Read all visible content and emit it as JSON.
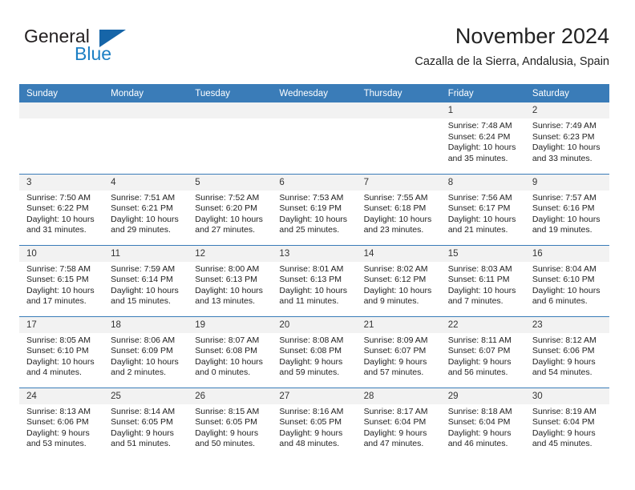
{
  "brand": {
    "name_part1": "General",
    "name_part2": "Blue"
  },
  "header": {
    "title": "November 2024",
    "subtitle": "Cazalla de la Sierra, Andalusia, Spain"
  },
  "colors": {
    "header_blue": "#3a7cb8",
    "brand_blue": "#1c7fc4",
    "daynum_band": "#f2f2f2"
  },
  "weekdays": [
    "Sunday",
    "Monday",
    "Tuesday",
    "Wednesday",
    "Thursday",
    "Friday",
    "Saturday"
  ],
  "weeks": [
    [
      {
        "day": "",
        "lines": []
      },
      {
        "day": "",
        "lines": []
      },
      {
        "day": "",
        "lines": []
      },
      {
        "day": "",
        "lines": []
      },
      {
        "day": "",
        "lines": []
      },
      {
        "day": "1",
        "lines": [
          "Sunrise: 7:48 AM",
          "Sunset: 6:24 PM",
          "Daylight: 10 hours",
          "and 35 minutes."
        ]
      },
      {
        "day": "2",
        "lines": [
          "Sunrise: 7:49 AM",
          "Sunset: 6:23 PM",
          "Daylight: 10 hours",
          "and 33 minutes."
        ]
      }
    ],
    [
      {
        "day": "3",
        "lines": [
          "Sunrise: 7:50 AM",
          "Sunset: 6:22 PM",
          "Daylight: 10 hours",
          "and 31 minutes."
        ]
      },
      {
        "day": "4",
        "lines": [
          "Sunrise: 7:51 AM",
          "Sunset: 6:21 PM",
          "Daylight: 10 hours",
          "and 29 minutes."
        ]
      },
      {
        "day": "5",
        "lines": [
          "Sunrise: 7:52 AM",
          "Sunset: 6:20 PM",
          "Daylight: 10 hours",
          "and 27 minutes."
        ]
      },
      {
        "day": "6",
        "lines": [
          "Sunrise: 7:53 AM",
          "Sunset: 6:19 PM",
          "Daylight: 10 hours",
          "and 25 minutes."
        ]
      },
      {
        "day": "7",
        "lines": [
          "Sunrise: 7:55 AM",
          "Sunset: 6:18 PM",
          "Daylight: 10 hours",
          "and 23 minutes."
        ]
      },
      {
        "day": "8",
        "lines": [
          "Sunrise: 7:56 AM",
          "Sunset: 6:17 PM",
          "Daylight: 10 hours",
          "and 21 minutes."
        ]
      },
      {
        "day": "9",
        "lines": [
          "Sunrise: 7:57 AM",
          "Sunset: 6:16 PM",
          "Daylight: 10 hours",
          "and 19 minutes."
        ]
      }
    ],
    [
      {
        "day": "10",
        "lines": [
          "Sunrise: 7:58 AM",
          "Sunset: 6:15 PM",
          "Daylight: 10 hours",
          "and 17 minutes."
        ]
      },
      {
        "day": "11",
        "lines": [
          "Sunrise: 7:59 AM",
          "Sunset: 6:14 PM",
          "Daylight: 10 hours",
          "and 15 minutes."
        ]
      },
      {
        "day": "12",
        "lines": [
          "Sunrise: 8:00 AM",
          "Sunset: 6:13 PM",
          "Daylight: 10 hours",
          "and 13 minutes."
        ]
      },
      {
        "day": "13",
        "lines": [
          "Sunrise: 8:01 AM",
          "Sunset: 6:13 PM",
          "Daylight: 10 hours",
          "and 11 minutes."
        ]
      },
      {
        "day": "14",
        "lines": [
          "Sunrise: 8:02 AM",
          "Sunset: 6:12 PM",
          "Daylight: 10 hours",
          "and 9 minutes."
        ]
      },
      {
        "day": "15",
        "lines": [
          "Sunrise: 8:03 AM",
          "Sunset: 6:11 PM",
          "Daylight: 10 hours",
          "and 7 minutes."
        ]
      },
      {
        "day": "16",
        "lines": [
          "Sunrise: 8:04 AM",
          "Sunset: 6:10 PM",
          "Daylight: 10 hours",
          "and 6 minutes."
        ]
      }
    ],
    [
      {
        "day": "17",
        "lines": [
          "Sunrise: 8:05 AM",
          "Sunset: 6:10 PM",
          "Daylight: 10 hours",
          "and 4 minutes."
        ]
      },
      {
        "day": "18",
        "lines": [
          "Sunrise: 8:06 AM",
          "Sunset: 6:09 PM",
          "Daylight: 10 hours",
          "and 2 minutes."
        ]
      },
      {
        "day": "19",
        "lines": [
          "Sunrise: 8:07 AM",
          "Sunset: 6:08 PM",
          "Daylight: 10 hours",
          "and 0 minutes."
        ]
      },
      {
        "day": "20",
        "lines": [
          "Sunrise: 8:08 AM",
          "Sunset: 6:08 PM",
          "Daylight: 9 hours",
          "and 59 minutes."
        ]
      },
      {
        "day": "21",
        "lines": [
          "Sunrise: 8:09 AM",
          "Sunset: 6:07 PM",
          "Daylight: 9 hours",
          "and 57 minutes."
        ]
      },
      {
        "day": "22",
        "lines": [
          "Sunrise: 8:11 AM",
          "Sunset: 6:07 PM",
          "Daylight: 9 hours",
          "and 56 minutes."
        ]
      },
      {
        "day": "23",
        "lines": [
          "Sunrise: 8:12 AM",
          "Sunset: 6:06 PM",
          "Daylight: 9 hours",
          "and 54 minutes."
        ]
      }
    ],
    [
      {
        "day": "24",
        "lines": [
          "Sunrise: 8:13 AM",
          "Sunset: 6:06 PM",
          "Daylight: 9 hours",
          "and 53 minutes."
        ]
      },
      {
        "day": "25",
        "lines": [
          "Sunrise: 8:14 AM",
          "Sunset: 6:05 PM",
          "Daylight: 9 hours",
          "and 51 minutes."
        ]
      },
      {
        "day": "26",
        "lines": [
          "Sunrise: 8:15 AM",
          "Sunset: 6:05 PM",
          "Daylight: 9 hours",
          "and 50 minutes."
        ]
      },
      {
        "day": "27",
        "lines": [
          "Sunrise: 8:16 AM",
          "Sunset: 6:05 PM",
          "Daylight: 9 hours",
          "and 48 minutes."
        ]
      },
      {
        "day": "28",
        "lines": [
          "Sunrise: 8:17 AM",
          "Sunset: 6:04 PM",
          "Daylight: 9 hours",
          "and 47 minutes."
        ]
      },
      {
        "day": "29",
        "lines": [
          "Sunrise: 8:18 AM",
          "Sunset: 6:04 PM",
          "Daylight: 9 hours",
          "and 46 minutes."
        ]
      },
      {
        "day": "30",
        "lines": [
          "Sunrise: 8:19 AM",
          "Sunset: 6:04 PM",
          "Daylight: 9 hours",
          "and 45 minutes."
        ]
      }
    ]
  ]
}
